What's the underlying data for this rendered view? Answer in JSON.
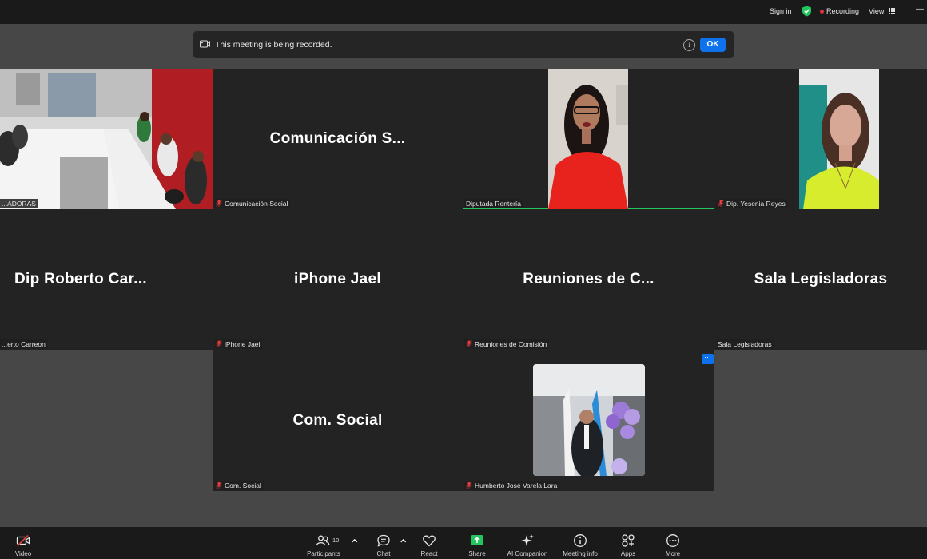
{
  "topbar": {
    "sign_in": "Sign in",
    "recording": "Recording",
    "view": "View"
  },
  "banner": {
    "message": "This meeting is being recorded.",
    "ok": "OK"
  },
  "tiles": {
    "t1": {
      "label": "...ADORAS"
    },
    "t2": {
      "name": "Comunicación S...",
      "label": "Comunicación Social"
    },
    "t3": {
      "label": "Diputada Rentería"
    },
    "t4": {
      "label": "Dip. Yesenia Reyes"
    },
    "t5": {
      "name": "Dip Roberto Car...",
      "label": "...erto Carreon"
    },
    "t6": {
      "name": "iPhone Jael",
      "label": "iPhone Jael"
    },
    "t7": {
      "name": "Reuniones de C...",
      "label": "Reuniones de Comisión"
    },
    "t8": {
      "name": "Sala Legisladoras",
      "label": "Sala Legisladoras"
    },
    "t9": {
      "name": "Com. Social",
      "label": "Com. Social"
    },
    "t10": {
      "label": "Humberto José Varela Lara"
    }
  },
  "toolbar": {
    "video": "Video",
    "participants": "Participants",
    "participants_count": "10",
    "chat": "Chat",
    "react": "React",
    "share": "Share",
    "ai_companion": "AI Companion",
    "meeting_info": "Meeting info",
    "apps": "Apps",
    "more": "More"
  },
  "colors": {
    "accent": "#0e72ed",
    "active_speaker": "#22c55e",
    "recording_dot": "#e0323c",
    "share": "#22c55e"
  }
}
